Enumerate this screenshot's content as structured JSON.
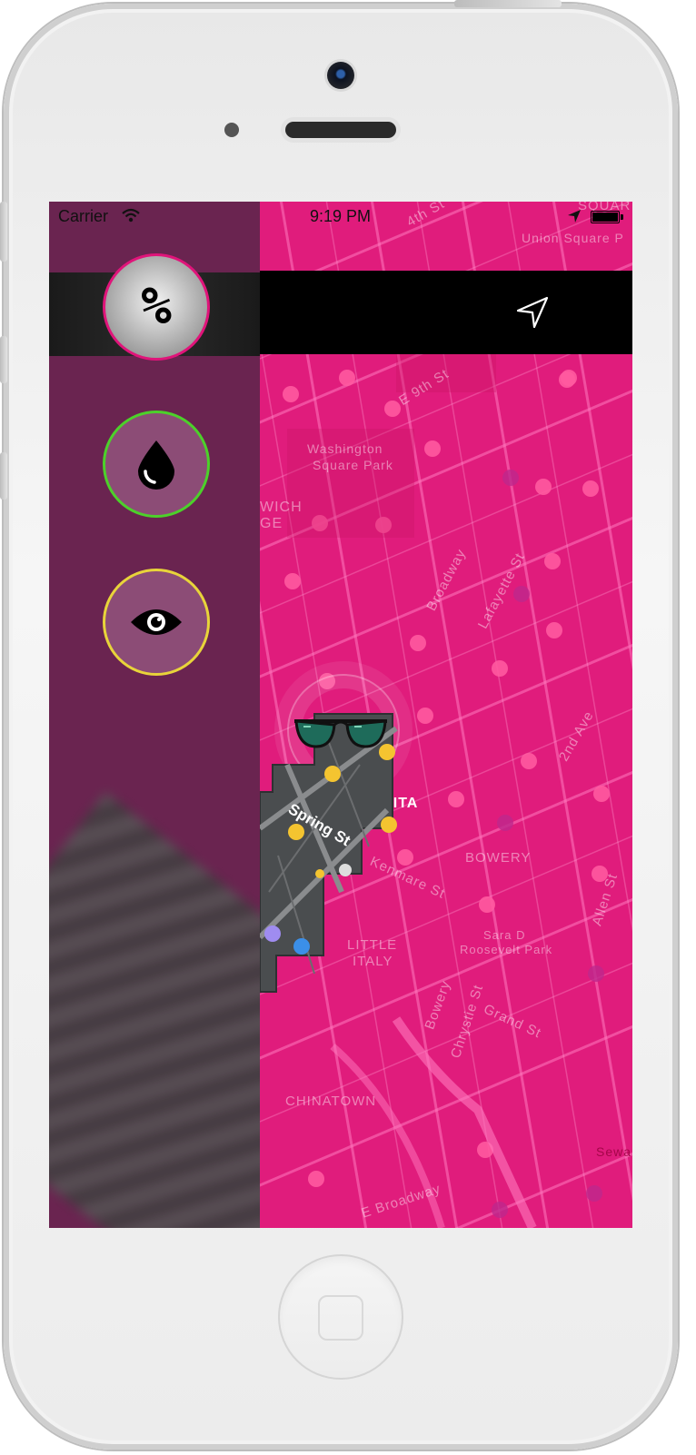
{
  "status_bar": {
    "carrier": "Carrier",
    "time": "9:19 PM"
  },
  "sidebar": {
    "buttons": [
      {
        "symbol": "%",
        "icon": "percent-icon",
        "ring_color": "#e0147a"
      },
      {
        "icon": "drop-icon",
        "ring_color": "#4cd12a"
      },
      {
        "icon": "eye-icon",
        "ring_color": "#e8d43a"
      }
    ]
  },
  "topbar": {
    "icon": "navigation-arrow-icon"
  },
  "map": {
    "tint_color": "#e01c7c",
    "labels": {
      "union_square": "Union Square P",
      "e9th": "E 9th St",
      "washington": "Washington",
      "washington2": "Square Park",
      "wich": "WICH",
      "ge": "GE",
      "broadway": "Broadway",
      "lafayette": "Lafayette St",
      "second_ave": "2nd Ave",
      "nolita": "NOLITA",
      "spring": "Spring St",
      "bowery_area": "BOWERY",
      "kenmare": "Kenmare St",
      "allen": "Allen St",
      "sara_d": "Sara D",
      "roosevelt": "Roosevelt Park",
      "little_italy": "LITTLE",
      "little_italy2": "ITALY",
      "bowery_st": "Bowery",
      "chrystie": "Chrystie St",
      "grand": "Grand St",
      "chinatown": "CHINATOWN",
      "seward": "Seward",
      "e_broadway": "E Broadway",
      "fourth": "4th St",
      "squar": "SQUAR"
    },
    "marker_icon": "sunglasses-icon"
  }
}
